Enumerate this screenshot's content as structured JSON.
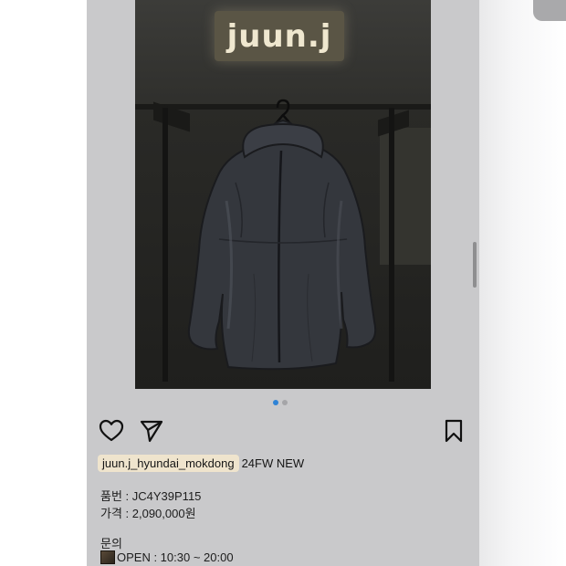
{
  "post": {
    "image": {
      "sign_text": "juun.j",
      "page_count": 2,
      "active_page": 1
    },
    "actions": {
      "like_icon": "heart-icon",
      "share_icon": "paper-plane-icon",
      "save_icon": "bookmark-icon"
    },
    "caption": {
      "username": "juun.j_hyundai_mokdong",
      "tag": "24FW NEW",
      "product_no": "품번 : JC4Y39P115",
      "price": "가격 : 2,090,000원",
      "inquiry": "문의",
      "hours": "OPEN : 10:30 ~ 20:00",
      "hours_icon": "package-box-emoji"
    }
  },
  "colors": {
    "panel_bg": "#c9c9cb",
    "active_dot": "#2f83d6",
    "username_highlight": "#efe4cd"
  }
}
